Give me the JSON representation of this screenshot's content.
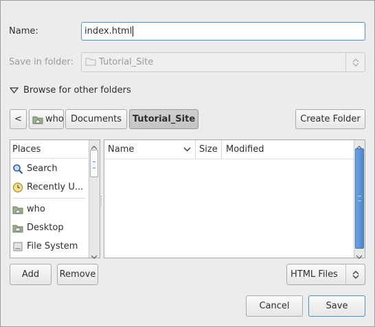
{
  "name_label": "Name:",
  "name_value": "index.html",
  "save_in_label": "Save in folder:",
  "save_in_value": "Tutorial_Site",
  "browse_label": "Browse for other folders",
  "path": {
    "back": "<",
    "crumbs": [
      "who",
      "Documents",
      "Tutorial_Site"
    ]
  },
  "create_folder": "Create Folder",
  "places": {
    "header": "Places",
    "items": [
      "Search",
      "Recently U...",
      "who",
      "Desktop",
      "File System"
    ]
  },
  "files": {
    "columns": [
      "Name",
      "Size",
      "Modified"
    ]
  },
  "add": "Add",
  "remove": "Remove",
  "filter": "HTML Files",
  "cancel": "Cancel",
  "save": "Save"
}
